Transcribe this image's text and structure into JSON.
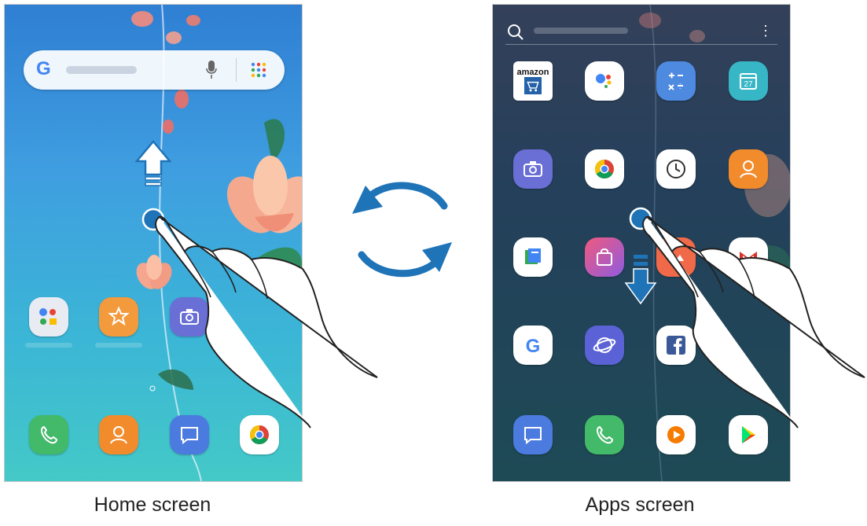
{
  "captions": {
    "home": "Home screen",
    "apps": "Apps screen"
  },
  "apps_screen": {
    "amazon_label": "amazon"
  },
  "colors": {
    "cycle_arrows": "#1f73b7",
    "touch_point": "#1f73b7",
    "swipe_arrow_down": "#1f73b7"
  },
  "icons": {
    "home_row1": [
      "google-folder-icon",
      "bixby-icon",
      "camera-icon"
    ],
    "home_dock": [
      "phone-icon",
      "contacts-icon",
      "messages-icon",
      "chrome-icon"
    ],
    "apps_rows": [
      [
        "amazon-shopping-icon",
        "google-assistant-go-icon",
        "calculator-icon",
        "calendar-icon"
      ],
      [
        "camera-icon",
        "chrome-icon",
        "clock-icon",
        "contacts-icon"
      ],
      [
        "files-go-icon",
        "galaxy-store-icon",
        "gallery-icon",
        "gmail-icon"
      ],
      [
        "google-go-icon",
        "internet-icon",
        "facebook-icon",
        "hidden-icon"
      ],
      [
        "messages-icon",
        "phone-icon",
        "play-music-icon",
        "play-store-icon"
      ]
    ]
  }
}
